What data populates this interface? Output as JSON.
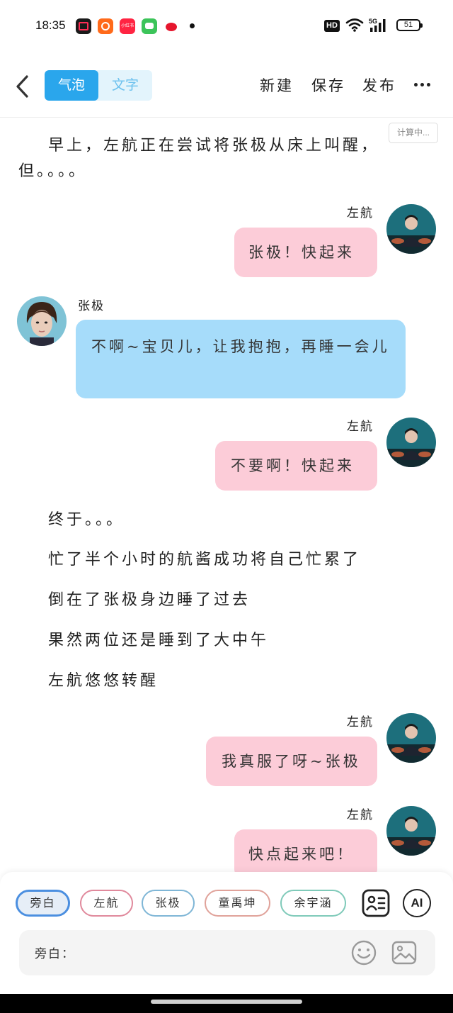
{
  "status_bar": {
    "time": "18:35",
    "hd": "HD",
    "network": "5G",
    "battery": "51"
  },
  "toolbar": {
    "tabs": [
      "气泡",
      "文字"
    ],
    "active_tab": "气泡",
    "new_label": "新建",
    "save_label": "保存",
    "publish_label": "发布",
    "accent_color": "#2aa6ec"
  },
  "calc_badge": "计算中...",
  "chat": {
    "narration_1": "早上，左航正在尝试将张极从床上叫醒，但。。。。",
    "msg1": {
      "speaker": "左航",
      "text": "张极！快起来"
    },
    "msg2": {
      "speaker": "张极",
      "text": "不啊~宝贝儿，让我抱抱，再睡一会儿"
    },
    "msg3": {
      "speaker": "左航",
      "text": "不要啊！快起来"
    },
    "narration_2": "终于。。。",
    "narration_3": "忙了半个小时的航酱成功将自己忙累了",
    "narration_4": "倒在了张极身边睡了过去",
    "narration_5": "果然两位还是睡到了大中午",
    "narration_6": "左航悠悠转醒",
    "msg4": {
      "speaker": "左航",
      "text": "我真服了呀~张极"
    },
    "msg5": {
      "speaker": "左航",
      "text": "快点起来吧！"
    }
  },
  "roles": [
    {
      "label": "旁白",
      "color": "#4b8fe0"
    },
    {
      "label": "左航",
      "color": "#e0899c"
    },
    {
      "label": "张极",
      "color": "#7fb6d6"
    },
    {
      "label": "童禹坤",
      "color": "#e0a29a"
    },
    {
      "label": "余宇涵",
      "color": "#7fcab9"
    }
  ],
  "selected_role": "旁白",
  "composer": {
    "label": "旁白：",
    "ai_label": "AI"
  },
  "icons": [
    "back-arrow-icon",
    "more-icon",
    "contacts-card-icon",
    "ai-icon",
    "emoji-icon",
    "image-icon"
  ]
}
